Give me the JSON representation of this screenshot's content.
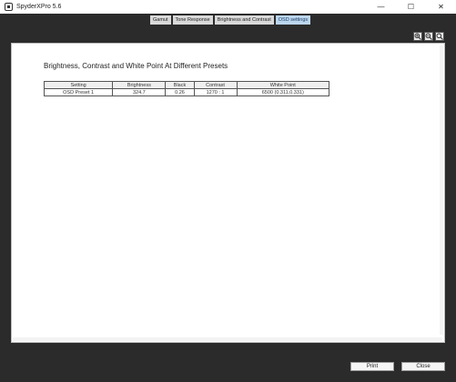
{
  "window": {
    "title": "SpyderXPro 5.6"
  },
  "window_controls": {
    "minimize": "—",
    "maximize": "☐",
    "close": "✕"
  },
  "tabs": [
    {
      "label": "Gamut"
    },
    {
      "label": "Tone Response"
    },
    {
      "label": "Brightness and Contrast"
    },
    {
      "label": "OSD settings"
    }
  ],
  "report": {
    "title": "Brightness, Contrast and White Point At Different Presets",
    "table": {
      "headers": [
        "Setting",
        "Brightness",
        "Black",
        "Contrast",
        "White Point"
      ],
      "rows": [
        [
          "OSD Preset 1",
          "324.7",
          "0.26",
          "1270 : 1",
          "6500 (0.311,0.331)"
        ]
      ]
    }
  },
  "footer": {
    "print_label": "Print",
    "close_label": "Close"
  },
  "colors": {
    "active_tab": "#bcd6ee",
    "app_background": "#2b2b2b"
  }
}
